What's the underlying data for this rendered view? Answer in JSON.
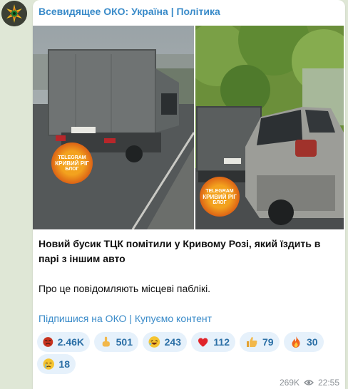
{
  "channel": {
    "name": "Всевидящее ОКО: Україна | Політика"
  },
  "photos": {
    "left": {
      "watermark_top": "TELEGRAM",
      "watermark_mid": "КРИВИЙ РІГ",
      "watermark_bottom": "БЛОГ"
    },
    "right": {
      "watermark_top": "TELEGRAM",
      "watermark_mid": "КРИВИЙ РІГ",
      "watermark_bottom": "БЛОГ"
    }
  },
  "message": {
    "headline": "Новий бусик ТЦК помітили у Кривому Розі, який їздить в парі з іншим авто",
    "body": "Про це повідомляють місцеві паблікі."
  },
  "links": {
    "subscribe": "Підпишися на ОКО",
    "separator": " | ",
    "buy": "Купуємо контент"
  },
  "reactions": [
    {
      "icon": "angry-face-icon",
      "count": "2.46K"
    },
    {
      "icon": "middle-finger-icon",
      "count": "501"
    },
    {
      "icon": "rofl-face-icon",
      "count": "243"
    },
    {
      "icon": "red-heart-icon",
      "count": "112"
    },
    {
      "icon": "thumbs-up-icon",
      "count": "79"
    },
    {
      "icon": "fire-icon",
      "count": "30"
    },
    {
      "icon": "crying-face-icon",
      "count": "18"
    }
  ],
  "meta": {
    "views": "269K",
    "time": "22:55"
  },
  "colors": {
    "link": "#3a8bc9",
    "reaction_bg": "#e6f1fb",
    "reaction_text": "#2b6fa6",
    "chat_bg": "#dfe7d6"
  }
}
